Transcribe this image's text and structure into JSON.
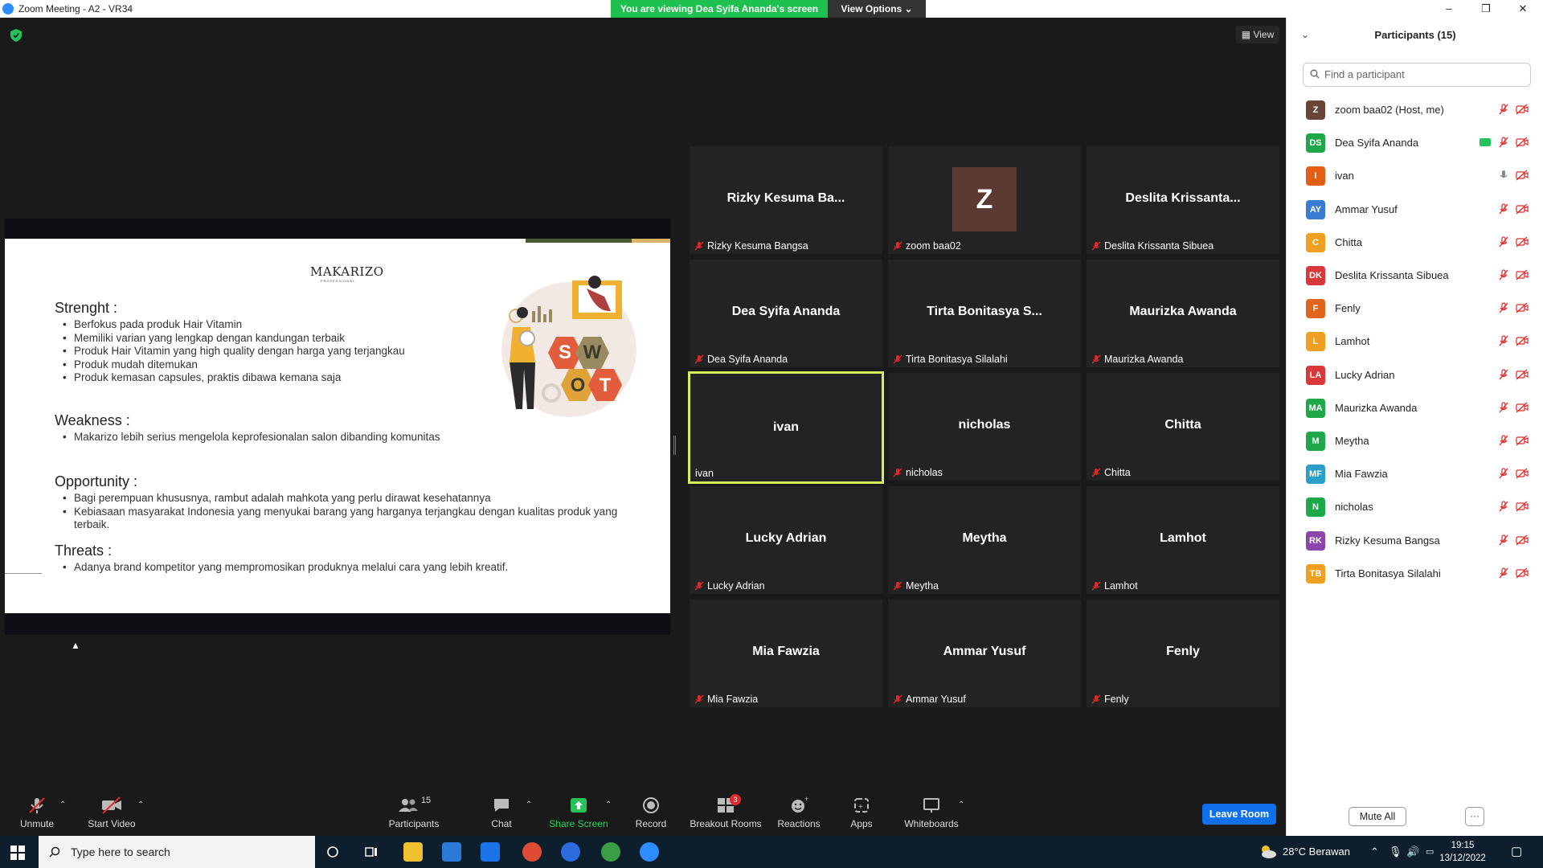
{
  "titlebar": {
    "title": "Zoom Meeting - A2 - VR34",
    "minimize": "–",
    "restore": "❐",
    "close": "✕"
  },
  "banner": {
    "viewing": "You are viewing Dea Syifa Ananda's screen",
    "options": "View Options ⌄"
  },
  "view_button": "View",
  "slide": {
    "logo": "MAKARIZO",
    "logo_sub": "PROFESSIONAL",
    "sections": [
      {
        "heading": "Strenght :",
        "items": [
          "Berfokus pada produk Hair Vitamin",
          "Memiliki varian yang lengkap dengan kandungan terbaik",
          "Produk Hair Vitamin yang high quality dengan harga yang terjangkau",
          "Produk mudah ditemukan",
          "Produk kemasan capsules, praktis dibawa kemana saja"
        ]
      },
      {
        "heading": "Weakness :",
        "items": [
          "Makarizo lebih serius mengelola keprofesionalan salon dibanding komunitas"
        ]
      },
      {
        "heading": "Opportunity :",
        "items": [
          "Bagi perempuan khususnya, rambut adalah mahkota yang perlu dirawat kesehatannya",
          "Kebiasaan masyarakat Indonesia yang menyukai barang yang harganya terjangkau dengan kualitas produk yang terbaik."
        ]
      },
      {
        "heading": "Threats :",
        "items": [
          "Adanya brand kompetitor yang mempromosikan produknya melalui cara yang lebih kreatif."
        ]
      }
    ],
    "swot_letters": [
      "S",
      "W",
      "O",
      "T"
    ]
  },
  "tiles": [
    {
      "name": "Rizky Kesuma Ba...",
      "label": "Rizky Kesuma Bangsa",
      "muted": true
    },
    {
      "name": "",
      "avatar": "Z",
      "label": "zoom baa02",
      "muted": true
    },
    {
      "name": "Deslita Krissanta...",
      "label": "Deslita Krissanta Sibuea",
      "muted": true
    },
    {
      "name": "Dea Syifa Ananda",
      "label": "Dea Syifa Ananda",
      "muted": true
    },
    {
      "name": "Tirta Bonitasya S...",
      "label": "Tirta Bonitasya Silalahi",
      "muted": true
    },
    {
      "name": "Maurizka Awanda",
      "label": "Maurizka Awanda",
      "muted": true
    },
    {
      "name": "ivan",
      "label": "ivan",
      "muted": false,
      "active": true
    },
    {
      "name": "nicholas",
      "label": "nicholas",
      "muted": true
    },
    {
      "name": "Chitta",
      "label": "Chitta",
      "muted": true
    },
    {
      "name": "Lucky Adrian",
      "label": "Lucky Adrian",
      "muted": true
    },
    {
      "name": "Meytha",
      "label": "Meytha",
      "muted": true
    },
    {
      "name": "Lamhot",
      "label": "Lamhot",
      "muted": true
    },
    {
      "name": "Mia Fawzia",
      "label": "Mia Fawzia",
      "muted": true
    },
    {
      "name": "Ammar Yusuf",
      "label": "Ammar Yusuf",
      "muted": true
    },
    {
      "name": "Fenly",
      "label": "Fenly",
      "muted": true
    }
  ],
  "toolbar": {
    "unmute": "Unmute",
    "start_video": "Start Video",
    "participants": "Participants",
    "participants_count": "15",
    "chat": "Chat",
    "share_screen": "Share Screen",
    "record": "Record",
    "breakout_rooms": "Breakout Rooms",
    "breakout_badge": "3",
    "reactions": "Reactions",
    "apps": "Apps",
    "whiteboards": "Whiteboards",
    "leave": "Leave Room"
  },
  "panel": {
    "title": "Participants (15)",
    "search_placeholder": "Find a participant",
    "participants": [
      {
        "initials": "Z",
        "name": "zoom baa02 (Host, me)",
        "color": "#6b4438",
        "mic": "muted"
      },
      {
        "initials": "DS",
        "name": "Dea Syifa Ananda",
        "color": "#1fa84a",
        "mic": "muted",
        "sharing": true
      },
      {
        "initials": "I",
        "name": "ivan",
        "color": "#e35d14",
        "mic": "on"
      },
      {
        "initials": "AY",
        "name": "Ammar Yusuf",
        "color": "#3a7bd5",
        "mic": "muted"
      },
      {
        "initials": "C",
        "name": "Chitta",
        "color": "#f0a020",
        "mic": "muted"
      },
      {
        "initials": "DK",
        "name": "Deslita Krissanta Sibuea",
        "color": "#d8383a",
        "mic": "muted"
      },
      {
        "initials": "F",
        "name": "Fenly",
        "color": "#e0641c",
        "mic": "muted"
      },
      {
        "initials": "L",
        "name": "Lamhot",
        "color": "#f0a020",
        "mic": "muted"
      },
      {
        "initials": "LA",
        "name": "Lucky Adrian",
        "color": "#d8383a",
        "mic": "muted"
      },
      {
        "initials": "MA",
        "name": "Maurizka Awanda",
        "color": "#1fa84a",
        "mic": "muted"
      },
      {
        "initials": "M",
        "name": "Meytha",
        "color": "#1fa84a",
        "mic": "muted"
      },
      {
        "initials": "MF",
        "name": "Mia Fawzia",
        "color": "#2aa0c8",
        "mic": "muted"
      },
      {
        "initials": "N",
        "name": "nicholas",
        "color": "#1fa84a",
        "mic": "muted"
      },
      {
        "initials": "RK",
        "name": "Rizky Kesuma Bangsa",
        "color": "#8e44ad",
        "mic": "muted"
      },
      {
        "initials": "TB",
        "name": "Tirta Bonitasya Silalahi",
        "color": "#f0a020",
        "mic": "muted"
      }
    ],
    "mute_all": "Mute All",
    "more": "···"
  },
  "taskbar": {
    "search_placeholder": "Type here to search",
    "weather": "28°C  Berawan",
    "time": "19:15",
    "date": "13/12/2022"
  }
}
